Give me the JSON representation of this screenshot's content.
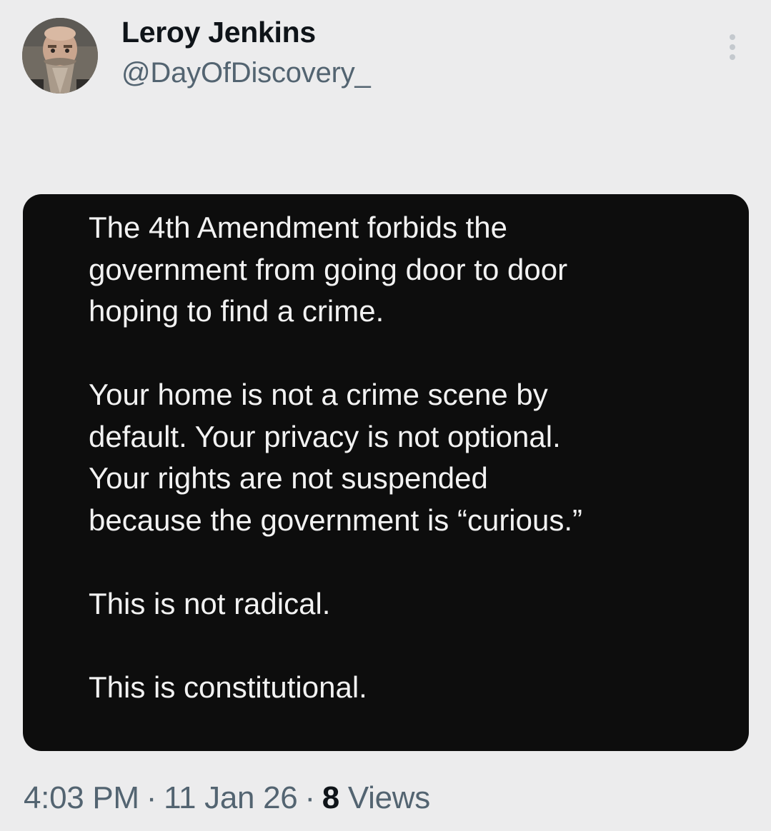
{
  "tweet": {
    "author": {
      "name": "Leroy Jenkins",
      "handle": "@DayOfDiscovery_",
      "avatar_icon": "user-avatar"
    },
    "more_icon": "more-vertical-icon",
    "media": {
      "paragraphs": [
        "The 4th Amendment forbids the\ngovernment from going door to door\nhoping to find a crime.",
        "Your home is not a crime scene by\ndefault. Your privacy is not optional.\nYour rights are not suspended\nbecause the government is “curious.”",
        "This is not radical.",
        "This is constitutional."
      ]
    },
    "meta": {
      "time": "4:03 PM",
      "separator": "·",
      "date": "11 Jan 26",
      "views_count": "8",
      "views_label": "Views"
    }
  },
  "colors": {
    "background": "#ececed",
    "text_primary": "#0f1419",
    "text_secondary": "#536471",
    "media_background": "#0d0d0d",
    "media_text": "#f2f2f2"
  }
}
